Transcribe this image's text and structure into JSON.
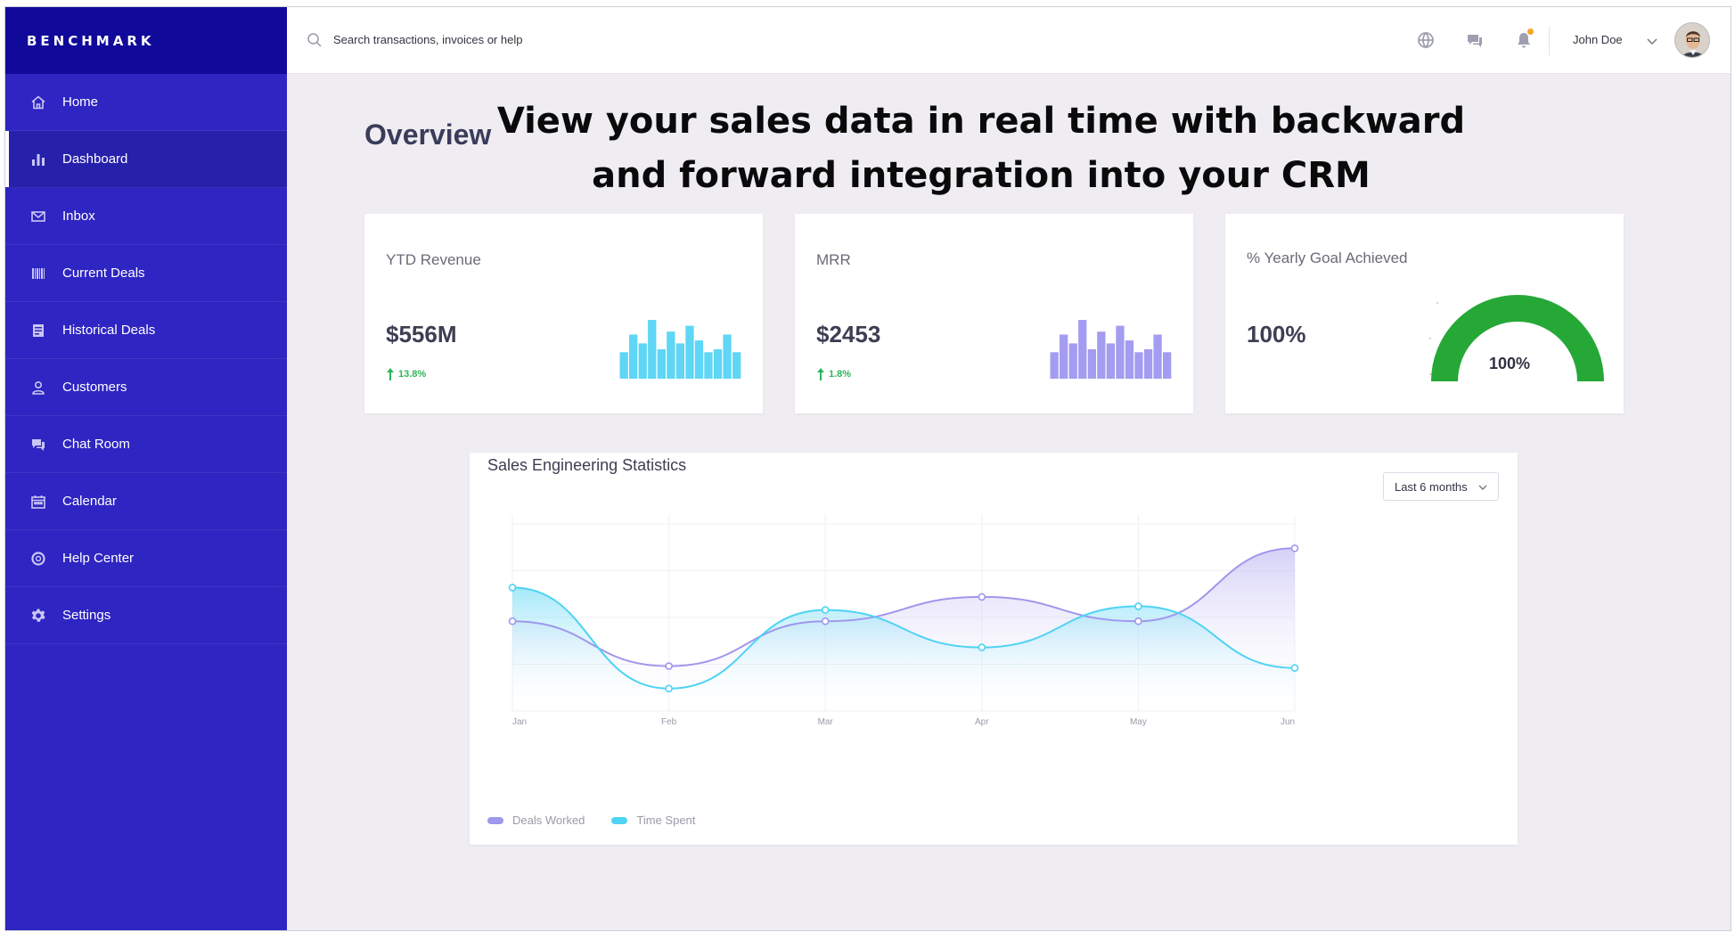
{
  "brand": {
    "name": "BENCHMARK"
  },
  "sidebar": {
    "items": [
      {
        "label": "Home",
        "icon": "home-icon"
      },
      {
        "label": "Dashboard",
        "icon": "bar-chart-icon",
        "active": true
      },
      {
        "label": "Inbox",
        "icon": "mail-icon"
      },
      {
        "label": "Current Deals",
        "icon": "barcode-icon"
      },
      {
        "label": "Historical Deals",
        "icon": "document-icon"
      },
      {
        "label": "Customers",
        "icon": "user-icon"
      },
      {
        "label": "Chat Room",
        "icon": "chat-icon"
      },
      {
        "label": "Calendar",
        "icon": "calendar-icon"
      },
      {
        "label": "Help Center",
        "icon": "lifebuoy-icon"
      },
      {
        "label": "Settings",
        "icon": "gear-icon"
      }
    ]
  },
  "topbar": {
    "search_placeholder": "Search transactions, invoices or help",
    "user_name": "John Doe"
  },
  "main": {
    "page_title": "Overview",
    "headline_line1": "View your sales data in real time with backward",
    "headline_line2": "and forward integration into your CRM"
  },
  "cards": {
    "ytd": {
      "title": "YTD Revenue",
      "value": "$556M",
      "change": "13.8%",
      "bar_color": "#5fd6f5"
    },
    "mrr": {
      "title": "MRR",
      "value": "$2453",
      "change": "1.8%",
      "bar_color": "#a49cf0"
    },
    "goal": {
      "title": "% Yearly Goal Achieved",
      "value": "100%",
      "gauge_label": "100%",
      "gauge_color": "#25a836",
      "progress": 1.0
    }
  },
  "chart": {
    "title": "Sales Engineering Statistics",
    "range_label": "Last 6 months"
  },
  "chart_data": {
    "type": "area",
    "title": "Sales Engineering Statistics",
    "categories": [
      "Jan",
      "Feb",
      "Mar",
      "Apr",
      "May",
      "Jun"
    ],
    "ylim": [
      0,
      100
    ],
    "grid": true,
    "legend": "bottom-left",
    "series": [
      {
        "name": "Deals Worked",
        "color": "#a097ec",
        "values": [
          48,
          24,
          48,
          61,
          48,
          87
        ]
      },
      {
        "name": "Time Spent",
        "color": "#4fd3f3",
        "values": [
          66,
          12,
          54,
          34,
          56,
          23
        ]
      }
    ]
  },
  "colors": {
    "sidebar_bg": "#2e25c2",
    "brand_bg": "#10099a",
    "page_bg": "#efedf2",
    "accent_green": "#2fb55a"
  }
}
